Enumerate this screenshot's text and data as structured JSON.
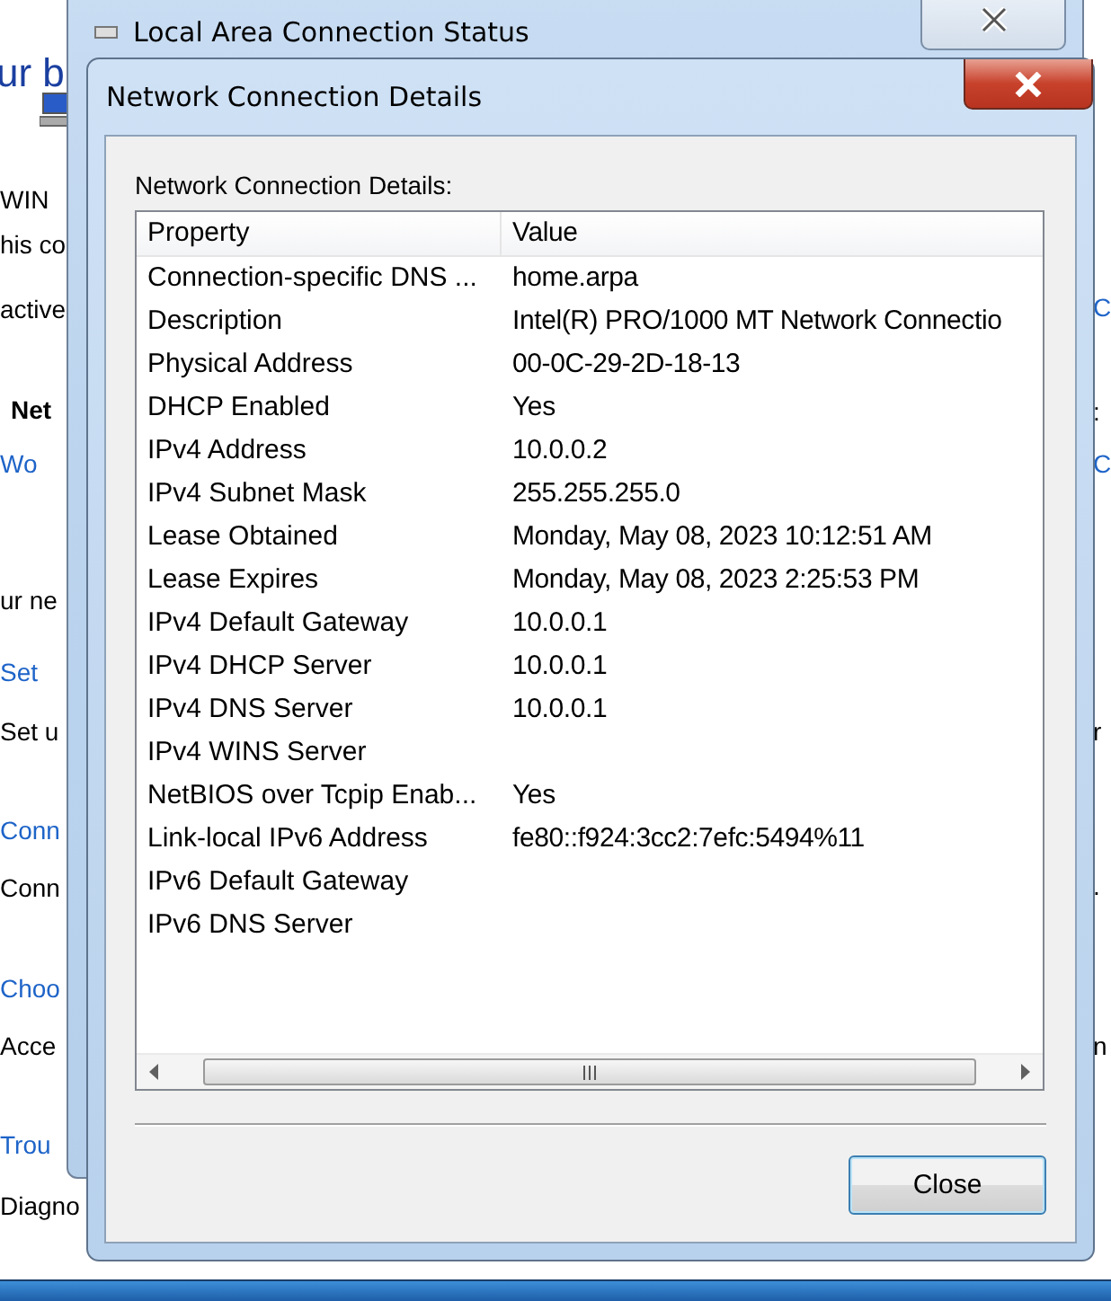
{
  "backdrop": {
    "left_fragments": [
      {
        "text": "ur b",
        "kind": "heading"
      },
      {
        "text": "WIN",
        "kind": "plain"
      },
      {
        "text": "his co",
        "kind": "plain"
      },
      {
        "text": "active",
        "kind": "plain"
      },
      {
        "text": "Net",
        "kind": "bold"
      },
      {
        "text": "Wo",
        "kind": "link"
      },
      {
        "text": "ur ne",
        "kind": "plain"
      },
      {
        "text": "Set",
        "kind": "link"
      },
      {
        "text": "Set u",
        "kind": "plain"
      },
      {
        "text": "Conn",
        "kind": "link"
      },
      {
        "text": "Conn",
        "kind": "plain"
      },
      {
        "text": "Choo",
        "kind": "link"
      },
      {
        "text": "Acce",
        "kind": "plain"
      },
      {
        "text": "Trou",
        "kind": "link"
      },
      {
        "text": "Diagno",
        "kind": "plain"
      }
    ],
    "right_fragments": [
      {
        "text": "C",
        "kind": "link"
      },
      {
        "text": ":",
        "kind": "plain"
      },
      {
        "text": "C",
        "kind": "link"
      },
      {
        "text": "r",
        "kind": "plain"
      },
      {
        "text": ".",
        "kind": "plain"
      },
      {
        "text": "n",
        "kind": "plain"
      }
    ]
  },
  "status_window": {
    "title": "Local Area Connection Status"
  },
  "dialog": {
    "title": "Network Connection Details",
    "label": "Network Connection Details:",
    "columns": [
      "Property",
      "Value"
    ],
    "rows": [
      {
        "property": "Connection-specific DNS ...",
        "value": "home.arpa"
      },
      {
        "property": "Description",
        "value": "Intel(R) PRO/1000 MT Network Connectio"
      },
      {
        "property": "Physical Address",
        "value": "00-0C-29-2D-18-13"
      },
      {
        "property": "DHCP Enabled",
        "value": "Yes"
      },
      {
        "property": "IPv4 Address",
        "value": "10.0.0.2"
      },
      {
        "property": "IPv4 Subnet Mask",
        "value": "255.255.255.0"
      },
      {
        "property": "Lease Obtained",
        "value": "Monday, May 08, 2023 10:12:51 AM"
      },
      {
        "property": "Lease Expires",
        "value": "Monday, May 08, 2023 2:25:53 PM"
      },
      {
        "property": "IPv4 Default Gateway",
        "value": "10.0.0.1"
      },
      {
        "property": "IPv4 DHCP Server",
        "value": "10.0.0.1"
      },
      {
        "property": "IPv4 DNS Server",
        "value": "10.0.0.1"
      },
      {
        "property": "IPv4 WINS Server"
      },
      {
        "property": "NetBIOS over Tcpip Enab...",
        "value": "Yes"
      },
      {
        "property": "Link-local IPv6 Address",
        "value": "fe80::f924:3cc2:7efc:5494%11"
      },
      {
        "property": "IPv6 Default Gateway"
      },
      {
        "property": "IPv6 DNS Server"
      }
    ],
    "buttons": [
      "Close"
    ]
  }
}
